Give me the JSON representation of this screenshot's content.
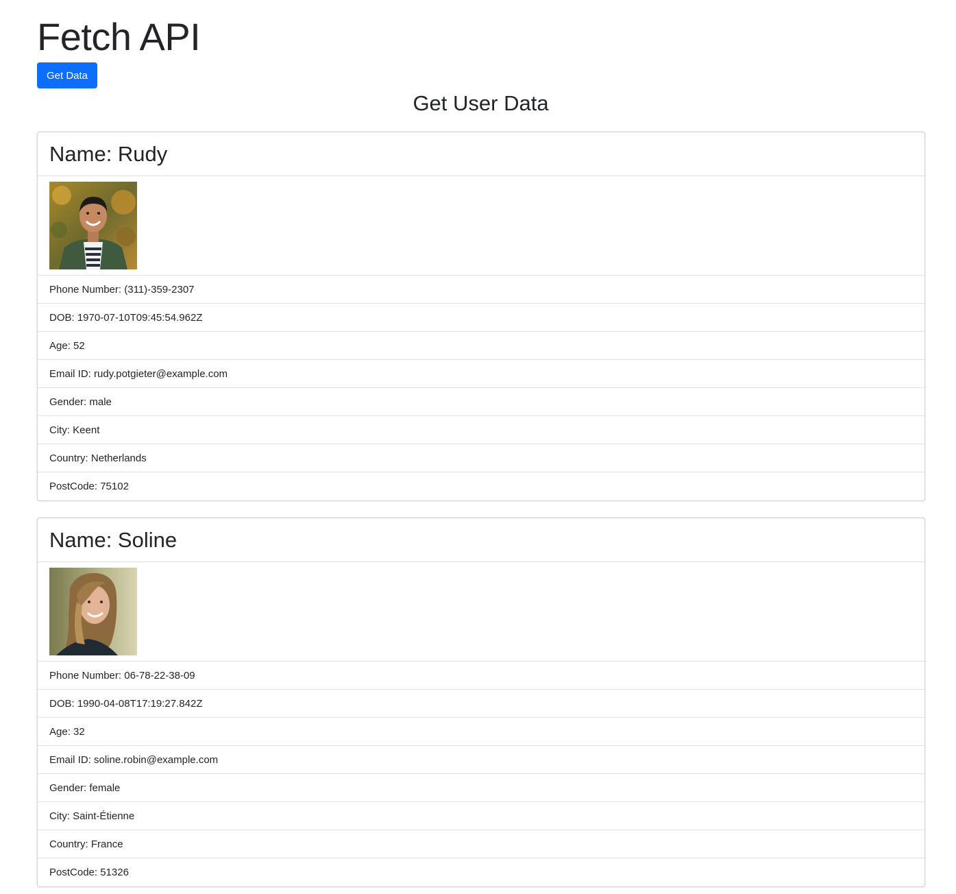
{
  "header": {
    "title": "Fetch API",
    "button_label": "Get Data",
    "section_heading": "Get User Data"
  },
  "colors": {
    "primary_button": "#0d6efd",
    "text": "#212529"
  },
  "users": [
    {
      "name_line": "Name: Rudy",
      "photo_desc": "man-portrait-photo",
      "fields": [
        "Phone Number: (311)-359-2307",
        "DOB: 1970-07-10T09:45:54.962Z",
        "Age: 52",
        "Email ID: rudy.potgieter@example.com",
        "Gender: male",
        "City: Keent",
        "Country: Netherlands",
        "PostCode: 75102"
      ]
    },
    {
      "name_line": "Name: Soline",
      "photo_desc": "woman-portrait-photo",
      "fields": [
        "Phone Number: 06-78-22-38-09",
        "DOB: 1990-04-08T17:19:27.842Z",
        "Age: 32",
        "Email ID: soline.robin@example.com",
        "Gender: female",
        "City: Saint-Étienne",
        "Country: France",
        "PostCode: 51326"
      ]
    }
  ]
}
